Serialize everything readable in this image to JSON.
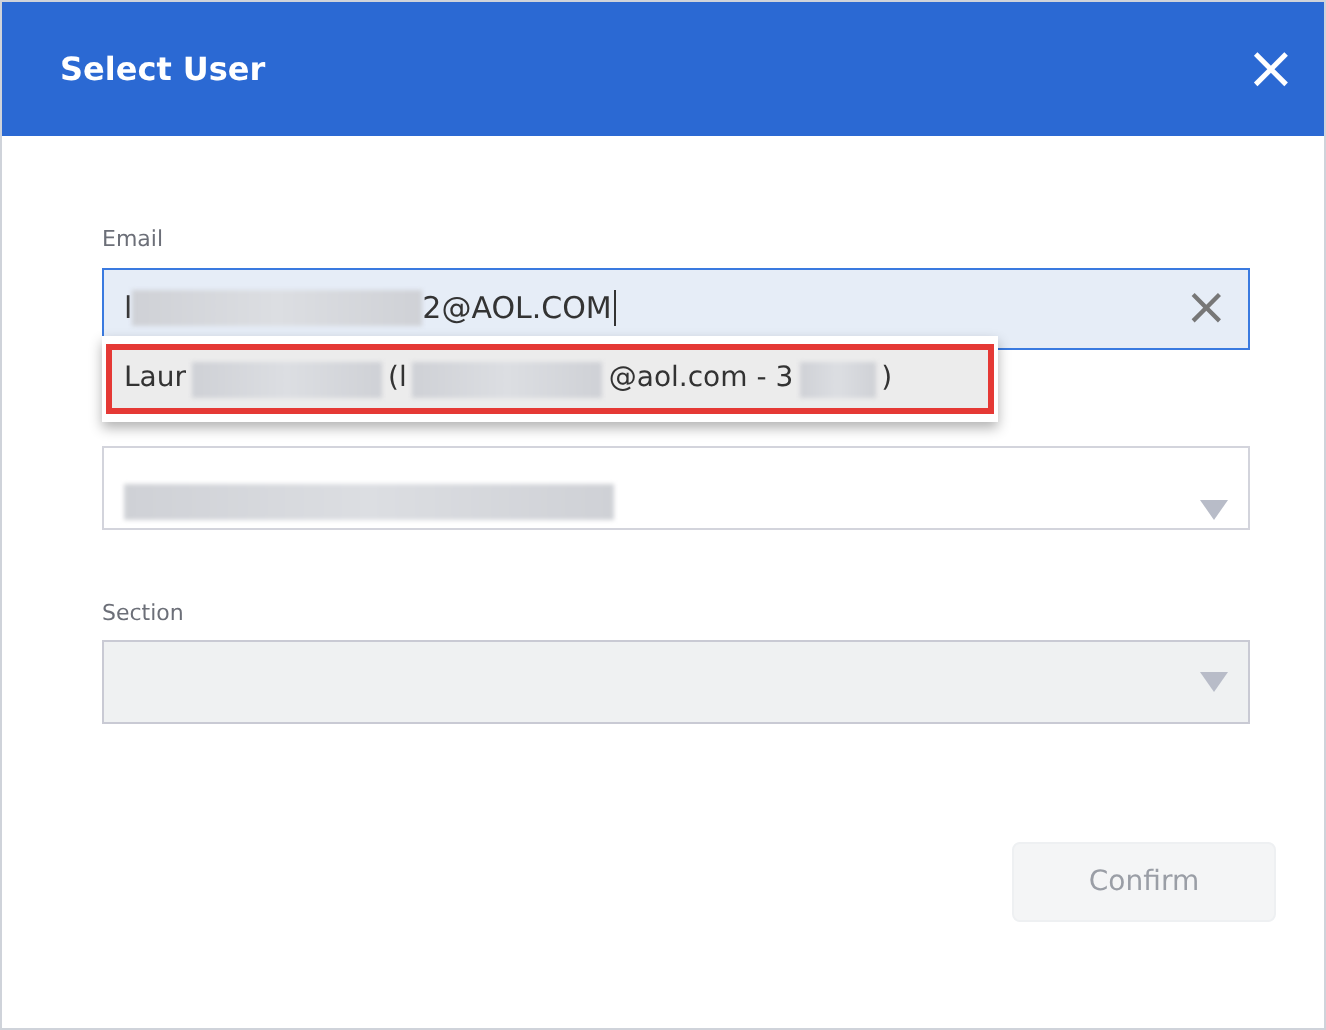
{
  "dialog": {
    "title": "Select User",
    "close": "×"
  },
  "email": {
    "label": "Email",
    "focused": true,
    "value_parts": [
      {
        "kind": "text",
        "text": "l"
      },
      {
        "kind": "redacted"
      },
      {
        "kind": "text",
        "text": "2@AOL.COM"
      }
    ],
    "clear": "×"
  },
  "suggestions": [
    {
      "highlighted": true,
      "parts": [
        {
          "kind": "text",
          "text": "Laur"
        },
        {
          "kind": "redacted"
        },
        {
          "kind": "text",
          "text": "(l"
        },
        {
          "kind": "redacted"
        },
        {
          "kind": "text",
          "text": "@aol.com - 3"
        },
        {
          "kind": "redacted"
        },
        {
          "kind": "text",
          "text": ")"
        }
      ]
    }
  ],
  "hidden_select": {
    "value_parts": [
      {
        "kind": "redacted"
      }
    ]
  },
  "section": {
    "label": "Section",
    "disabled": true
  },
  "confirm": {
    "label": "Confirm",
    "disabled": true
  }
}
